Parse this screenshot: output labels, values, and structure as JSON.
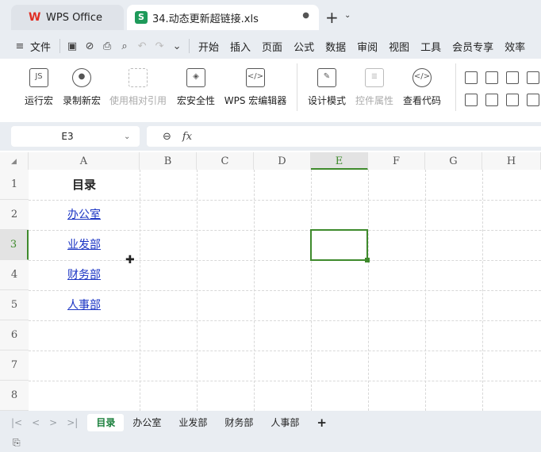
{
  "tabs": {
    "app_label": "WPS Office",
    "file_label": "34.动态更新超链接.xls",
    "modified_dot": "●",
    "new_tab": "+",
    "tab_menu": "⌄"
  },
  "menu": {
    "file": "文件",
    "items": [
      "开始",
      "插入",
      "页面",
      "公式",
      "数据",
      "审阅",
      "视图",
      "工具",
      "会员专享",
      "效率"
    ]
  },
  "ribbon": {
    "buttons": [
      {
        "label": "运行宏",
        "icon": "run-macro-icon",
        "enabled": true
      },
      {
        "label": "录制新宏",
        "icon": "record-macro-icon",
        "enabled": true
      },
      {
        "label": "使用相对引用",
        "icon": "relative-ref-icon",
        "enabled": false
      },
      {
        "label": "宏安全性",
        "icon": "macro-security-icon",
        "enabled": true
      },
      {
        "label": "WPS 宏编辑器",
        "icon": "macro-editor-icon",
        "enabled": true
      },
      {
        "label": "设计模式",
        "icon": "design-mode-icon",
        "enabled": true
      },
      {
        "label": "控件属性",
        "icon": "control-properties-icon",
        "enabled": false
      },
      {
        "label": "查看代码",
        "icon": "view-code-icon",
        "enabled": true
      }
    ]
  },
  "formula_bar": {
    "name_box": "E3",
    "fx_symbol": "fx",
    "zoom_symbol": "⊖",
    "formula": ""
  },
  "grid": {
    "columns": [
      "A",
      "B",
      "C",
      "D",
      "E",
      "F",
      "G",
      "H"
    ],
    "rows": [
      "1",
      "2",
      "3",
      "4",
      "5",
      "6",
      "7",
      "8"
    ],
    "cells": {
      "A1": "目录",
      "A2": "办公室",
      "A3": "业发部",
      "A4": "财务部",
      "A5": "人事部"
    },
    "active_cell": "E3"
  },
  "sheets": {
    "tabs": [
      "目录",
      "办公室",
      "业发部",
      "财务部",
      "人事部"
    ],
    "active": "目录",
    "add": "+"
  },
  "colors": {
    "accent_green": "#3e8a2c",
    "link_blue": "#1b35c4",
    "chrome_bg": "#e9edf2"
  }
}
